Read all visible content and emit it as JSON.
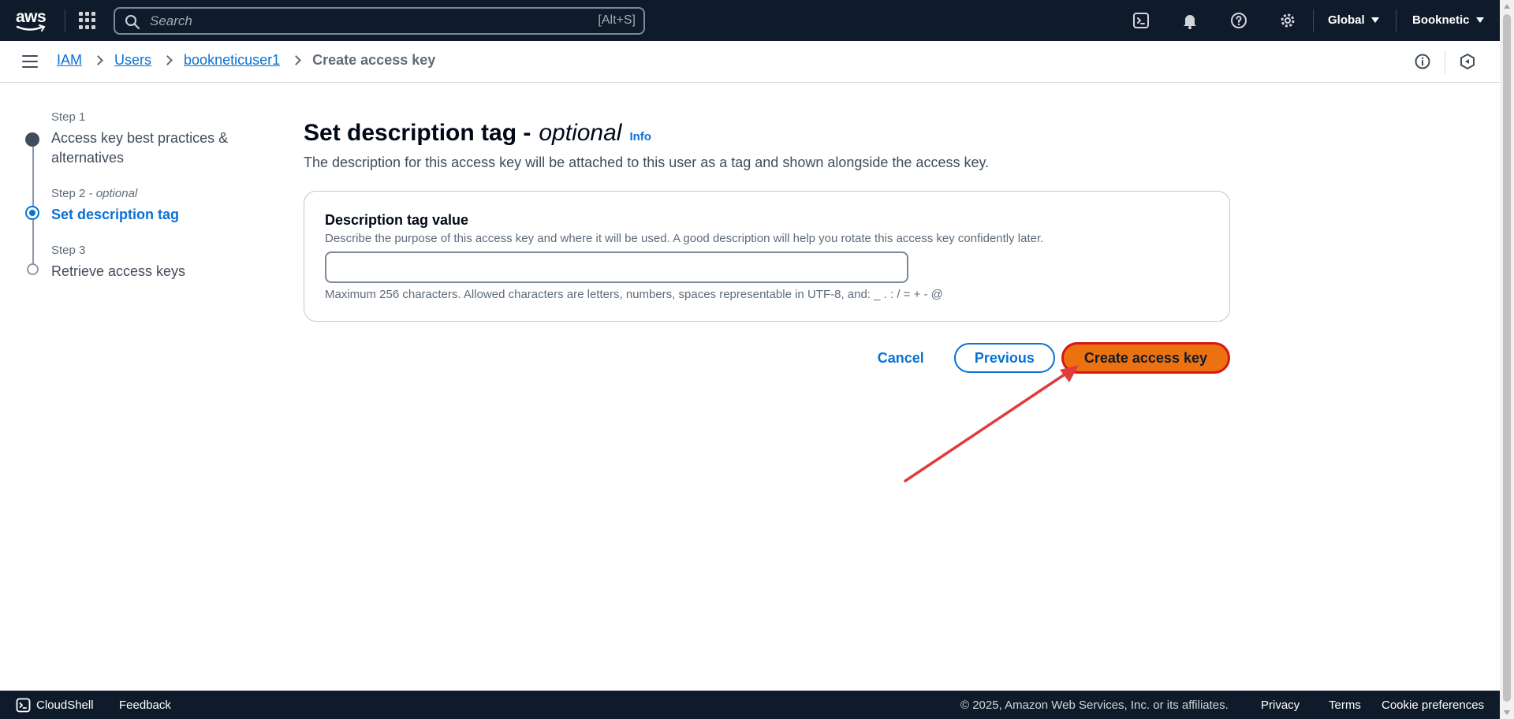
{
  "topnav": {
    "logo_text": "aws",
    "search": {
      "placeholder": "Search",
      "shortcut": "[Alt+S]"
    },
    "region": "Global",
    "account": "Booknetic",
    "icons": [
      "cloudshell-icon",
      "bell-icon",
      "help-icon",
      "settings-icon"
    ]
  },
  "breadcrumb": {
    "items": [
      "IAM",
      "Users",
      "bookneticuser1"
    ],
    "current": "Create access key"
  },
  "steps": [
    {
      "label": "Step 1",
      "title": "Access key best practices & alternatives"
    },
    {
      "label": "Step 2",
      "label_suffix": " - optional",
      "title": "Set description tag"
    },
    {
      "label": "Step 3",
      "title": "Retrieve access keys"
    }
  ],
  "main": {
    "title": "Set description tag -",
    "title_optional": "optional",
    "info": "Info",
    "description": "The description for this access key will be attached to this user as a tag and shown alongside the access key.",
    "field": {
      "label": "Description tag value",
      "description": "Describe the purpose of this access key and where it will be used. A good description will help you rotate this access key confidently later.",
      "value": "",
      "hint": "Maximum 256 characters. Allowed characters are letters, numbers, spaces representable in UTF-8, and: _ . : / = + - @"
    },
    "actions": {
      "cancel": "Cancel",
      "previous": "Previous",
      "create": "Create access key"
    }
  },
  "footer": {
    "cloudshell": "CloudShell",
    "feedback": "Feedback",
    "copyright": "© 2025, Amazon Web Services, Inc. or its affiliates.",
    "privacy": "Privacy",
    "terms": "Terms",
    "cookies": "Cookie preferences"
  },
  "colors": {
    "nav_bg": "#0f1b2a",
    "link": "#0972d3",
    "primary": "#ec7211",
    "annotation": "#d91515"
  }
}
